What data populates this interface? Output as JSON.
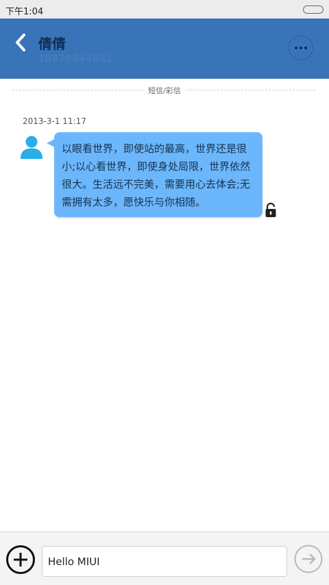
{
  "status_bar": {
    "time": "下午1:04"
  },
  "header": {
    "contact_name": "倩倩",
    "contact_number": "18670844681"
  },
  "conversation": {
    "divider_label": "短信/彩信",
    "messages": [
      {
        "timestamp": "2013-3-1 11:17",
        "text": "以眼看世界，即使站的最高，世界还是很小;以心看世界，即使身处局限，世界依然很大。生活远不完美，需要用心去体会;无需拥有太多，愿快乐与你相随。"
      }
    ]
  },
  "composer": {
    "input_value": "Hello MIUI"
  },
  "colors": {
    "header_bg": "#3a74b8",
    "bubble_bg": "#6cb7fb",
    "avatar": "#29aee6"
  },
  "icons": [
    "back-arrow-icon",
    "more-dots-icon",
    "contact-avatar-icon",
    "lock-icon",
    "add-icon",
    "send-arrow-icon"
  ]
}
